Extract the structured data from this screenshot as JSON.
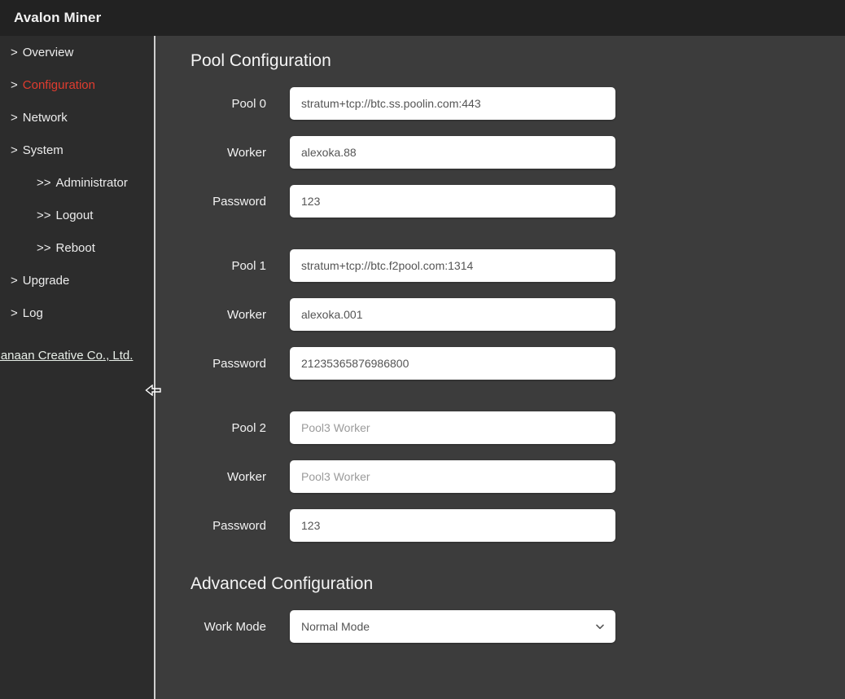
{
  "header": {
    "title": "Avalon Miner"
  },
  "sidebar": {
    "items": [
      {
        "prefix": ">",
        "label": "Overview",
        "level": 1,
        "active": false
      },
      {
        "prefix": ">",
        "label": "Configuration",
        "level": 1,
        "active": true
      },
      {
        "prefix": ">",
        "label": "Network",
        "level": 1,
        "active": false
      },
      {
        "prefix": ">",
        "label": "System",
        "level": 1,
        "active": false
      },
      {
        "prefix": ">>",
        "label": "Administrator",
        "level": 2,
        "active": false
      },
      {
        "prefix": ">>",
        "label": "Logout",
        "level": 2,
        "active": false
      },
      {
        "prefix": ">>",
        "label": "Reboot",
        "level": 2,
        "active": false
      },
      {
        "prefix": ">",
        "label": "Upgrade",
        "level": 1,
        "active": false
      },
      {
        "prefix": ">",
        "label": "Log",
        "level": 1,
        "active": false
      }
    ],
    "footer_link": "Canaan Creative Co., Ltd.",
    "collapse_icon": "left-arrow-icon"
  },
  "main": {
    "pool_section": {
      "title": "Pool Configuration",
      "groups": [
        {
          "url_label": "Pool 0",
          "url_value": "stratum+tcp://btc.ss.poolin.com:443",
          "url_is_placeholder": false,
          "worker_label": "Worker",
          "worker_value": "alexoka.88",
          "worker_is_placeholder": false,
          "password_label": "Password",
          "password_value": "123",
          "password_is_placeholder": false
        },
        {
          "url_label": "Pool 1",
          "url_value": "stratum+tcp://btc.f2pool.com:1314",
          "url_is_placeholder": false,
          "worker_label": "Worker",
          "worker_value": "alexoka.001",
          "worker_is_placeholder": false,
          "password_label": "Password",
          "password_value": "21235365876986800",
          "password_is_placeholder": false
        },
        {
          "url_label": "Pool 2",
          "url_value": "Pool3 Worker",
          "url_is_placeholder": true,
          "worker_label": "Worker",
          "worker_value": "Pool3 Worker",
          "worker_is_placeholder": true,
          "password_label": "Password",
          "password_value": "123",
          "password_is_placeholder": false
        }
      ]
    },
    "advanced_section": {
      "title": "Advanced Configuration",
      "work_mode_label": "Work Mode",
      "work_mode_value": "Normal Mode",
      "work_mode_options": [
        "Normal Mode"
      ],
      "chevron_icon": "chevron-down-icon"
    }
  },
  "colors": {
    "header_bg": "#222222",
    "sidebar_bg": "#2c2c2c",
    "main_bg": "#3c3c3c",
    "active_nav": "#e03c2f",
    "field_bg": "#ffffff",
    "field_text": "#555555",
    "placeholder_text": "#9b9b9b",
    "divider": "#cfcfcf"
  }
}
